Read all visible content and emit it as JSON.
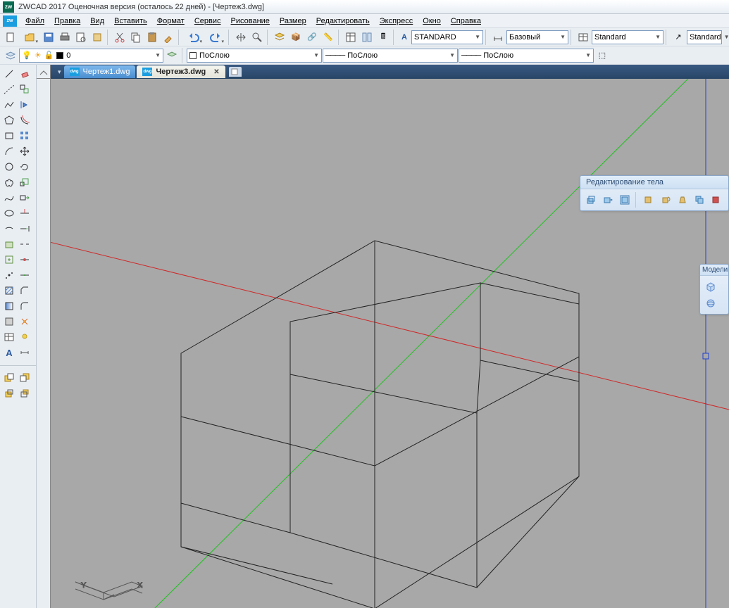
{
  "title": "ZWCAD 2017 Оценочная версия (осталось 22 дней) - [Чертеж3.dwg]",
  "appIconText": "zw",
  "menus": [
    "Файл",
    "Правка",
    "Вид",
    "Вставить",
    "Формат",
    "Сервис",
    "Рисование",
    "Размер",
    "Редактировать",
    "Экспресс",
    "Окно",
    "Справка"
  ],
  "layer": {
    "current": "0",
    "colorSwatch": "#000000"
  },
  "styles": {
    "textStyle": "STANDARD",
    "dimStyle": "Базовый",
    "tableStyle": "Standard",
    "otherStyle": "Standard"
  },
  "properties": {
    "color": "ПоСлою",
    "linetype": "ПоСлою",
    "lineweight": "ПоСлою"
  },
  "tabs": [
    {
      "label": "Чертеж1.dwg",
      "active": false
    },
    {
      "label": "Чертеж3.dwg",
      "active": true
    }
  ],
  "panels": {
    "solidEdit": "Редактирование тела",
    "modeling": "Модели"
  },
  "colors": {
    "accent": "#1a9ee0",
    "panelBg": "#e9eef3",
    "canvas": "#a8a8a8",
    "xAxis": "#d02828",
    "yAxis": "#20c020",
    "zAxis": "#2040d0"
  }
}
